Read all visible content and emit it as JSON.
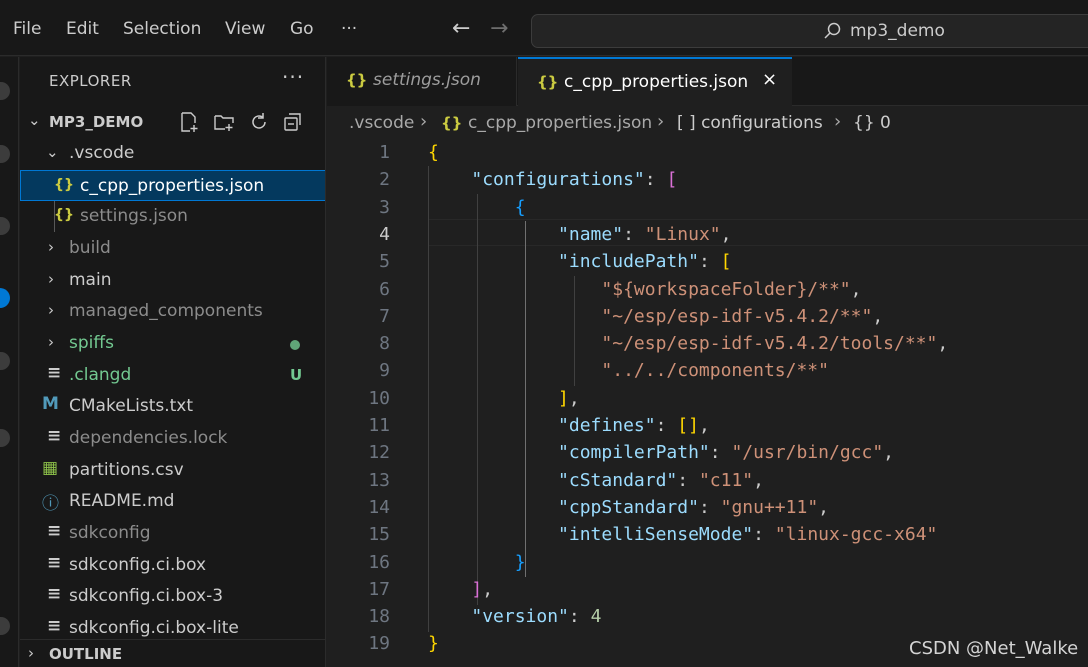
{
  "menu": {
    "items": [
      "File",
      "Edit",
      "Selection",
      "View",
      "Go"
    ],
    "more": "···"
  },
  "nav": {
    "back": "←",
    "forward": "→"
  },
  "search": {
    "text": "mp3_demo"
  },
  "sidebar": {
    "header": "EXPLORER",
    "more": "···",
    "folder": "MP3_DEMO",
    "tree": [
      {
        "label": ".vscode",
        "type": "folder-open",
        "icon": "chevron-down"
      },
      {
        "label": "c_cpp_properties.json",
        "type": "json",
        "icon": "{}",
        "selected": true
      },
      {
        "label": "settings.json",
        "type": "json",
        "icon": "{}"
      },
      {
        "label": "build",
        "type": "folder",
        "icon": "chevron-right"
      },
      {
        "label": "main",
        "type": "folder",
        "icon": "chevron-right"
      },
      {
        "label": "managed_components",
        "type": "folder",
        "icon": "chevron-right"
      },
      {
        "label": "spiffs",
        "type": "folder",
        "icon": "chevron-right",
        "git": "modified-dot"
      },
      {
        "label": ".clangd",
        "type": "file",
        "icon": "≡",
        "git": "U"
      },
      {
        "label": "CMakeLists.txt",
        "type": "cmake",
        "icon": "M"
      },
      {
        "label": "dependencies.lock",
        "type": "file",
        "icon": "≡"
      },
      {
        "label": "partitions.csv",
        "type": "csv",
        "icon": "▦"
      },
      {
        "label": "README.md",
        "type": "info",
        "icon": "ⓘ"
      },
      {
        "label": "sdkconfig",
        "type": "file",
        "icon": "≡"
      },
      {
        "label": "sdkconfig.ci.box",
        "type": "file",
        "icon": "≡"
      },
      {
        "label": "sdkconfig.ci.box-3",
        "type": "file",
        "icon": "≡"
      },
      {
        "label": "sdkconfig.ci.box-lite",
        "type": "file",
        "icon": "≡"
      }
    ],
    "outline": "OUTLINE"
  },
  "tabs": [
    {
      "label": "settings.json",
      "icon": "{}",
      "active": false
    },
    {
      "label": "c_cpp_properties.json",
      "icon": "{}",
      "active": true,
      "close": "×"
    }
  ],
  "breadcrumb": {
    "folder": ".vscode",
    "file": "c_cpp_properties.json",
    "section": "[ ] configurations",
    "item": "{} 0",
    "sep": "›"
  },
  "editor": {
    "current_line": 4,
    "line_numbers": [
      "1",
      "2",
      "3",
      "4",
      "5",
      "6",
      "7",
      "8",
      "9",
      "10",
      "11",
      "12",
      "13",
      "14",
      "15",
      "16",
      "17",
      "18",
      "19"
    ],
    "lines": [
      [
        [
          "t-p1",
          "{"
        ]
      ],
      [
        [
          "",
          "    "
        ],
        [
          "t-key",
          "\"configurations\""
        ],
        [
          "",
          ": "
        ],
        [
          "t-p2",
          "["
        ]
      ],
      [
        [
          "",
          "        "
        ],
        [
          "t-p3",
          "{"
        ]
      ],
      [
        [
          "",
          "            "
        ],
        [
          "t-key",
          "\"name\""
        ],
        [
          "",
          ": "
        ],
        [
          "t-str",
          "\"Linux\""
        ],
        [
          "",
          ","
        ]
      ],
      [
        [
          "",
          "            "
        ],
        [
          "t-key",
          "\"includePath\""
        ],
        [
          "",
          ": "
        ],
        [
          "t-p1",
          "["
        ]
      ],
      [
        [
          "",
          "                "
        ],
        [
          "t-str",
          "\"${workspaceFolder}/**\""
        ],
        [
          "",
          ","
        ]
      ],
      [
        [
          "",
          "                "
        ],
        [
          "t-str",
          "\"~/esp/esp-idf-v5.4.2/**\""
        ],
        [
          "",
          ","
        ]
      ],
      [
        [
          "",
          "                "
        ],
        [
          "t-str",
          "\"~/esp/esp-idf-v5.4.2/tools/**\""
        ],
        [
          "",
          ","
        ]
      ],
      [
        [
          "",
          "                "
        ],
        [
          "t-str",
          "\"../../components/**\""
        ]
      ],
      [
        [
          "",
          "            "
        ],
        [
          "t-p1",
          "]"
        ],
        [
          "",
          ","
        ]
      ],
      [
        [
          "",
          "            "
        ],
        [
          "t-key",
          "\"defines\""
        ],
        [
          "",
          ": "
        ],
        [
          "t-p1",
          "[]"
        ],
        [
          "",
          ","
        ]
      ],
      [
        [
          "",
          "            "
        ],
        [
          "t-key",
          "\"compilerPath\""
        ],
        [
          "",
          ": "
        ],
        [
          "t-str",
          "\"/usr/bin/gcc\""
        ],
        [
          "",
          ","
        ]
      ],
      [
        [
          "",
          "            "
        ],
        [
          "t-key",
          "\"cStandard\""
        ],
        [
          "",
          ": "
        ],
        [
          "t-str",
          "\"c11\""
        ],
        [
          "",
          ","
        ]
      ],
      [
        [
          "",
          "            "
        ],
        [
          "t-key",
          "\"cppStandard\""
        ],
        [
          "",
          ": "
        ],
        [
          "t-str",
          "\"gnu++11\""
        ],
        [
          "",
          ","
        ]
      ],
      [
        [
          "",
          "            "
        ],
        [
          "t-key",
          "\"intelliSenseMode\""
        ],
        [
          "",
          ": "
        ],
        [
          "t-str",
          "\"linux-gcc-x64\""
        ]
      ],
      [
        [
          "",
          "        "
        ],
        [
          "t-p3",
          "}"
        ]
      ],
      [
        [
          "",
          "    "
        ],
        [
          "t-p2",
          "]"
        ],
        [
          "",
          ","
        ]
      ],
      [
        [
          "",
          "    "
        ],
        [
          "t-key",
          "\"version\""
        ],
        [
          "",
          ": "
        ],
        [
          "t-num",
          "4"
        ]
      ],
      [
        [
          "t-p1",
          "}"
        ]
      ]
    ]
  },
  "watermark": "CSDN @Net_Walke",
  "colors": {
    "accent": "#0078d4",
    "json_icon": "#cbcb41",
    "git_green": "#73c991",
    "cmake": "#519aba"
  }
}
